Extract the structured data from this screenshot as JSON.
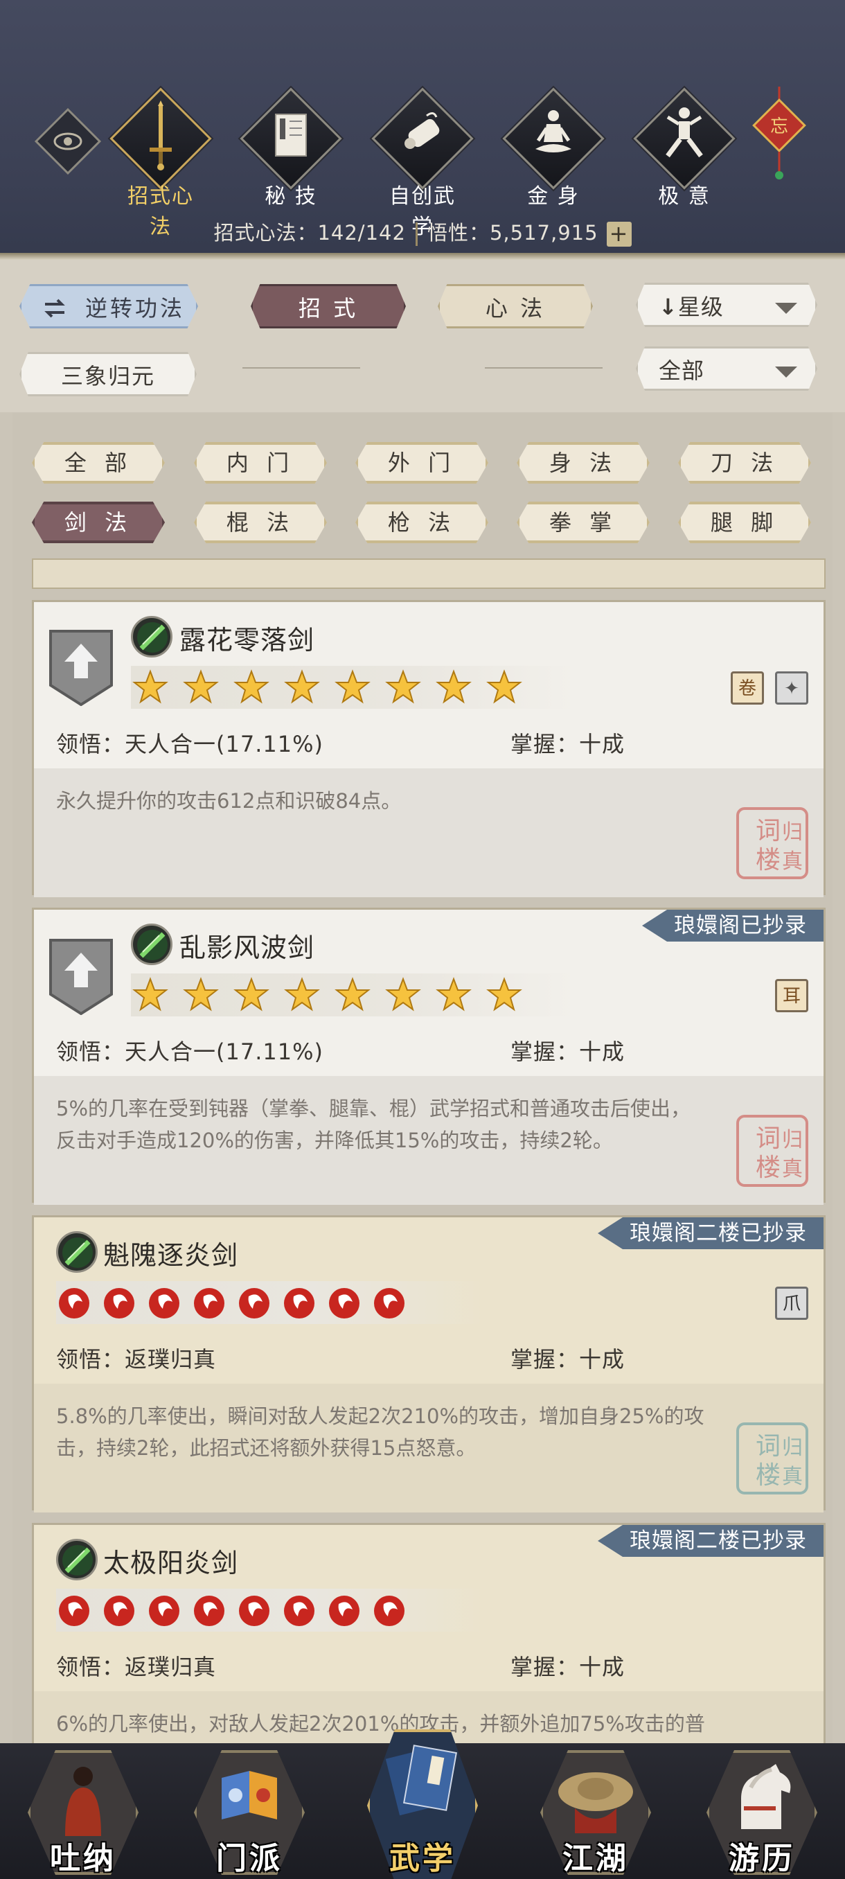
{
  "top_tabs": [
    {
      "label": "招式心法",
      "icon": "sword-icon",
      "active": true
    },
    {
      "label": "秘 技",
      "icon": "book-icon",
      "active": false
    },
    {
      "label": "自创武学",
      "icon": "scroll-icon",
      "active": false
    },
    {
      "label": "金 身",
      "icon": "meditation-icon",
      "active": false
    },
    {
      "label": "极 意",
      "icon": "martial-stance-icon",
      "active": false
    }
  ],
  "wang_badge": "忘",
  "stats": {
    "skills_label": "招式心法：",
    "skills_value": "142/142",
    "insight_label": "悟性：",
    "insight_value": "5,517,915",
    "plus": "+"
  },
  "controls": {
    "reverse_label": "逆转功法",
    "moves_label": "招 式",
    "mental_label": "心 法",
    "sort_label": "星级",
    "sanxiang_label": "三象归元",
    "filter_all_label": "全部"
  },
  "filters": [
    {
      "label": "全 部",
      "active": false
    },
    {
      "label": "内 门",
      "active": false
    },
    {
      "label": "外 门",
      "active": false
    },
    {
      "label": "身 法",
      "active": false
    },
    {
      "label": "刀 法",
      "active": false
    },
    {
      "label": "剑 法",
      "active": true
    },
    {
      "label": "棍 法",
      "active": false
    },
    {
      "label": "枪 法",
      "active": false
    },
    {
      "label": "拳 掌",
      "active": false
    },
    {
      "label": "腿 脚",
      "active": false
    }
  ],
  "skills": [
    {
      "name": "露花零落剑",
      "stars": 8,
      "star_type": "gold-star",
      "insight_label": "领悟：",
      "insight": "天人合一(17.11%)",
      "mastery_label": "掌握：",
      "mastery": "十成",
      "description_lines": [
        "永久提升你的攻击612点和识破84点。"
      ],
      "tag": "",
      "seal": "归真词楼"
    },
    {
      "name": "乱影风波剑",
      "stars": 8,
      "star_type": "gold-star",
      "insight_label": "领悟：",
      "insight": "天人合一(17.11%)",
      "mastery_label": "掌握：",
      "mastery": "十成",
      "description_lines": [
        "5%的几率在受到钝器（掌拳、腿靠、棍）武学招式和普通攻击后使出，",
        "反击对手造成120%的伤害，并降低其15%的攻击，持续2轮。"
      ],
      "tag": "琅嬛阁已抄录",
      "seal": "归真词楼"
    },
    {
      "name": "魁隗逐炎剑",
      "stars": 8,
      "star_type": "red-flame-orb",
      "insight_label": "领悟：",
      "insight": "返璞归真",
      "mastery_label": "掌握：",
      "mastery": "十成",
      "description_lines": [
        "5.8%的几率使出，瞬间对敌人发起2次210%的攻击，增加自身25%的攻",
        "击，持续2轮，此招式还将额外获得15点怒意。"
      ],
      "tag": "琅嬛阁二楼已抄录",
      "seal": "归真词楼"
    },
    {
      "name": "太极阳炎剑",
      "stars": 8,
      "star_type": "red-flame-orb",
      "insight_label": "领悟：",
      "insight": "返璞归真",
      "mastery_label": "掌握：",
      "mastery": "十成",
      "description_lines": [
        "6%的几率使出，对敌人发起2次201%的攻击，并额外追加75%攻击的普"
      ],
      "tag": "琅嬛阁二楼已抄录",
      "seal": ""
    }
  ],
  "bottom_nav": [
    {
      "label": "吐纳",
      "icon": "monk-icon",
      "active": false
    },
    {
      "label": "门派",
      "icon": "sect-banner-icon",
      "active": false
    },
    {
      "label": "武学",
      "icon": "manual-book-icon",
      "active": true
    },
    {
      "label": "江湖",
      "icon": "straw-hat-icon",
      "active": false
    },
    {
      "label": "游历",
      "icon": "white-horse-icon",
      "active": false
    }
  ],
  "colors": {
    "accent_gold": "#f2cf67",
    "header_bg": "#3b4054",
    "tag_bg": "#596e85",
    "active_filter": "#806065"
  }
}
